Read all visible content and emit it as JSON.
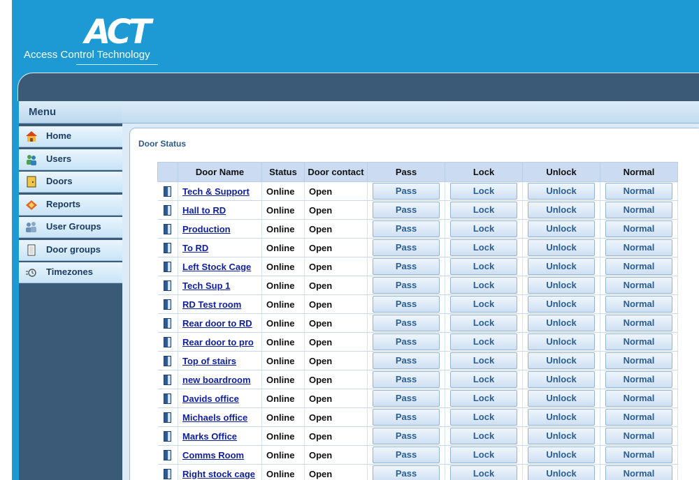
{
  "brand": {
    "logo": "ACT",
    "subtitle": "Access Control Technology"
  },
  "menu": {
    "title": "Menu",
    "items": [
      {
        "label": "Home",
        "icon": "home-icon"
      },
      {
        "label": "Users",
        "icon": "users-icon"
      },
      {
        "label": "Doors",
        "icon": "door-icon"
      },
      {
        "label": "Reports",
        "icon": "reports-icon"
      },
      {
        "label": "User Groups",
        "icon": "user-groups-icon"
      },
      {
        "label": "Door groups",
        "icon": "door-groups-icon"
      },
      {
        "label": "Timezones",
        "icon": "timezones-icon"
      }
    ]
  },
  "page": {
    "title": "Door Status"
  },
  "table": {
    "columns": [
      "Door Name",
      "Status",
      "Door contact",
      "Pass",
      "Lock",
      "Unlock",
      "Normal"
    ],
    "button_labels": {
      "pass": "Pass",
      "lock": "Lock",
      "unlock": "Unlock",
      "normal": "Normal"
    },
    "rows": [
      {
        "name": "Tech & Support",
        "status": "Online",
        "contact": "Open"
      },
      {
        "name": "Hall to RD",
        "status": "Online",
        "contact": "Open"
      },
      {
        "name": "Production",
        "status": "Online",
        "contact": "Open"
      },
      {
        "name": "To RD",
        "status": "Online",
        "contact": "Open"
      },
      {
        "name": "Left Stock Cage",
        "status": "Online",
        "contact": "Open"
      },
      {
        "name": "Tech Sup 1",
        "status": "Online",
        "contact": "Open"
      },
      {
        "name": "RD Test room",
        "status": "Online",
        "contact": "Open"
      },
      {
        "name": "Rear door to RD",
        "status": "Online",
        "contact": "Open"
      },
      {
        "name": "Rear door to pro",
        "status": "Online",
        "contact": "Open"
      },
      {
        "name": "Top of stairs",
        "status": "Online",
        "contact": "Open"
      },
      {
        "name": "new boardroom",
        "status": "Online",
        "contact": "Open"
      },
      {
        "name": "Davids office",
        "status": "Online",
        "contact": "Open"
      },
      {
        "name": "Michaels office",
        "status": "Online",
        "contact": "Open"
      },
      {
        "name": "Marks Office",
        "status": "Online",
        "contact": "Open"
      },
      {
        "name": "Comms Room",
        "status": "Online",
        "contact": "Open"
      },
      {
        "name": "Right stock cage",
        "status": "Online",
        "contact": "Open"
      }
    ]
  },
  "colors": {
    "header": "#1d9ad4",
    "navbar": "#3a5a78",
    "link": "#0f1f9e",
    "button_text": "#2b5e93",
    "table_header": "#cbdcf2"
  }
}
